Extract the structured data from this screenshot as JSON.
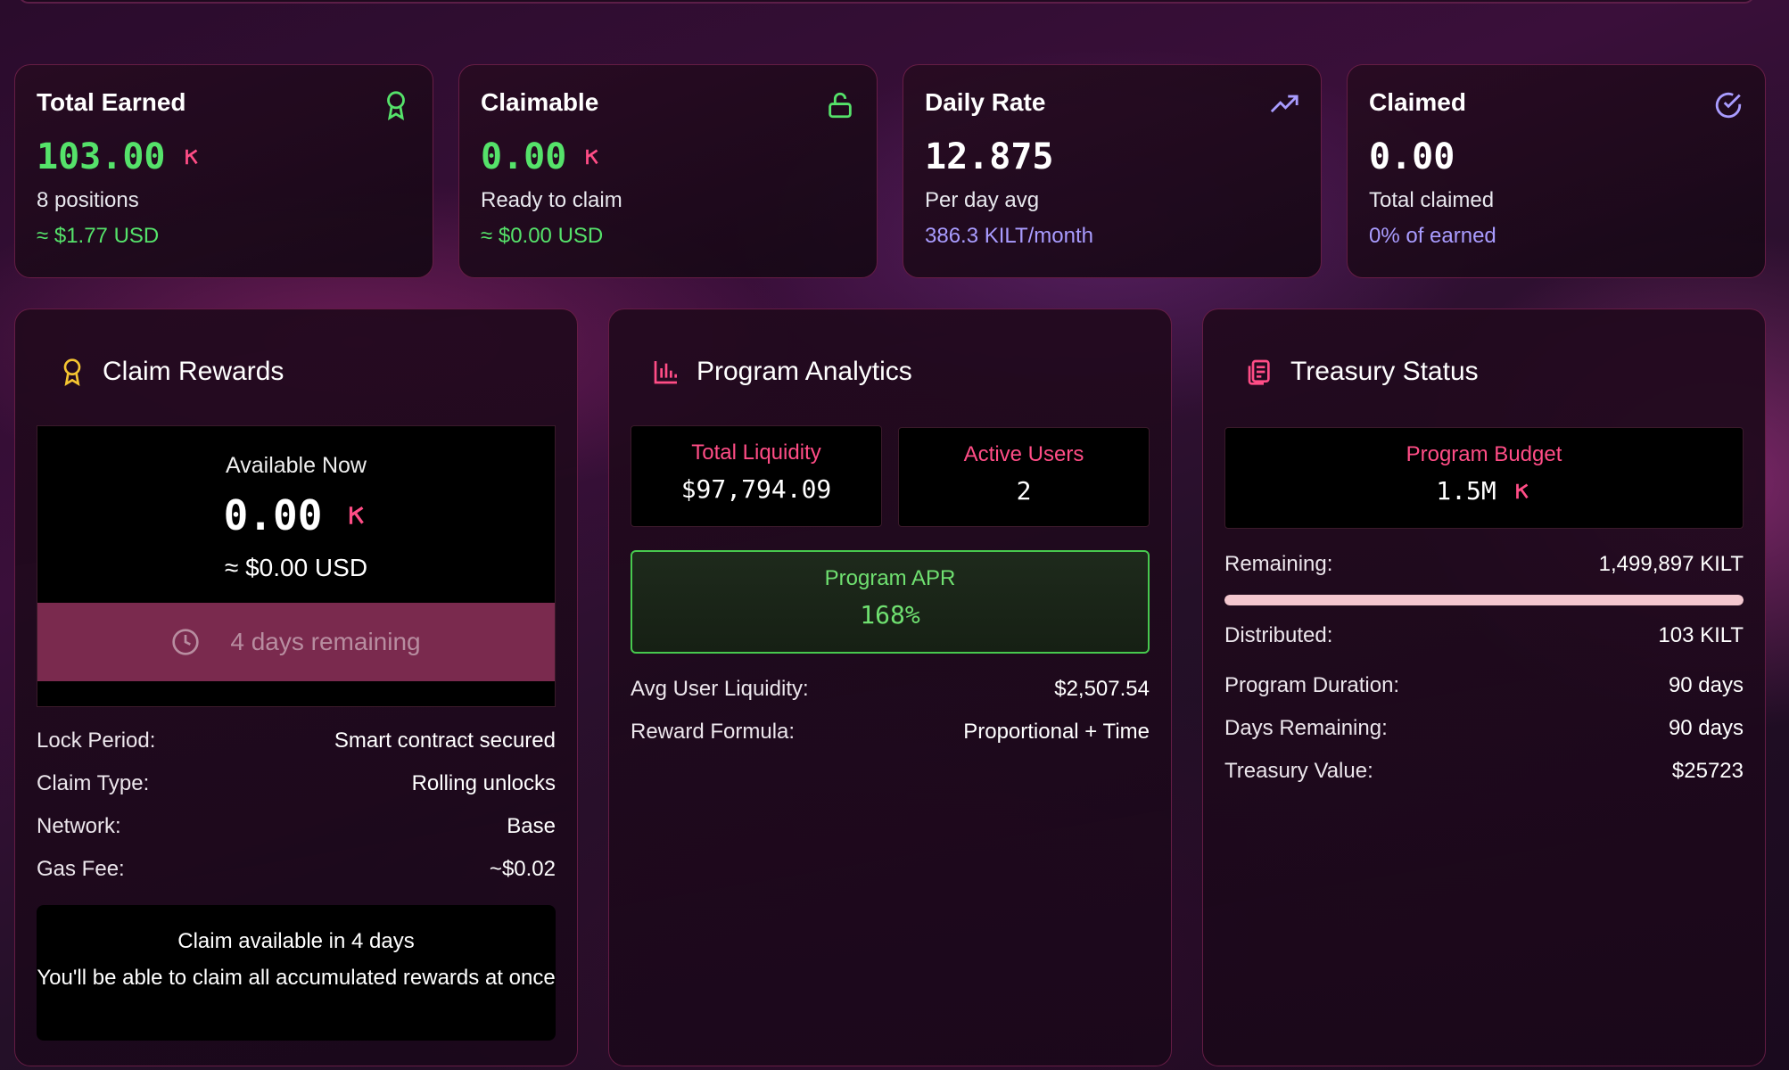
{
  "stats": [
    {
      "title": "Total Earned",
      "icon": "award-icon",
      "value": "103.00",
      "value_color": "green",
      "sub": "8 positions",
      "sub2": "≈ $1.77 USD",
      "sub2_color": "green"
    },
    {
      "title": "Claimable",
      "icon": "unlock-icon",
      "value": "0.00",
      "value_color": "green",
      "sub": "Ready to claim",
      "sub2": "≈ $0.00 USD",
      "sub2_color": "green"
    },
    {
      "title": "Daily Rate",
      "icon": "trending-up-icon",
      "value": "12.875",
      "value_color": "white",
      "sub": "Per day avg",
      "sub2": "386.3 KILT/month",
      "sub2_color": "purple"
    },
    {
      "title": "Claimed",
      "icon": "check-circle-icon",
      "value": "0.00",
      "value_color": "white",
      "sub": "Total claimed",
      "sub2": "0% of earned",
      "sub2_color": "purple"
    }
  ],
  "claim_panel": {
    "title": "Claim Rewards",
    "available_label": "Available Now",
    "available_value": "0.00",
    "available_usd": "≈ $0.00 USD",
    "lock_text": "4 days remaining",
    "rows": [
      {
        "key": "Lock Period:",
        "value": "Smart contract secured"
      },
      {
        "key": "Claim Type:",
        "value": "Rolling unlocks"
      },
      {
        "key": "Network:",
        "value": "Base"
      },
      {
        "key": "Gas Fee:",
        "value": "~$0.02"
      }
    ],
    "note_line1": "Claim available in 4 days",
    "note_line2": "You'll be able to claim all accumulated rewards at once"
  },
  "analytics_panel": {
    "title": "Program Analytics",
    "total_liquidity_label": "Total Liquidity",
    "total_liquidity_value": "$97,794.09",
    "active_users_label": "Active Users",
    "active_users_value": "2",
    "apr_label": "Program APR",
    "apr_value": "168%",
    "rows": [
      {
        "key": "Avg User Liquidity:",
        "value": "$2,507.54"
      },
      {
        "key": "Reward Formula:",
        "value": "Proportional + Time"
      }
    ]
  },
  "treasury_panel": {
    "title": "Treasury Status",
    "budget_label": "Program Budget",
    "budget_value": "1.5M",
    "remaining_label": "Remaining:",
    "remaining_value": "1,499,897 KILT",
    "remaining_fraction": 0.99993,
    "rows": [
      {
        "key": "Distributed:",
        "value": "103 KILT"
      },
      {
        "key": "Program Duration:",
        "value": "90 days"
      },
      {
        "key": "Days Remaining:",
        "value": "90 days"
      },
      {
        "key": "Treasury Value:",
        "value": "$25723"
      }
    ]
  },
  "colors": {
    "accent_pink": "#ff4d86",
    "green": "#55e26a",
    "purple": "#a99cff",
    "lock_bar": "#7a2a4e"
  }
}
